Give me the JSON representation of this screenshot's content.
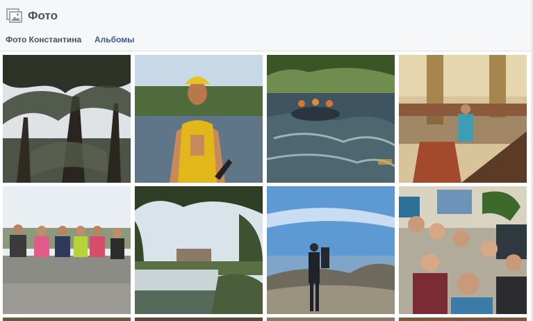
{
  "header": {
    "title": "Фото",
    "icon": "photos-icon"
  },
  "tabs": [
    {
      "label": "Фото Константина",
      "active": true
    },
    {
      "label": "Альбомы",
      "active": false
    }
  ],
  "colors": {
    "tab_link": "#365899",
    "header_bg": "#f6f7f9",
    "title": "#4b4f56"
  },
  "photos": [
    {
      "subject": "trees against the sky"
    },
    {
      "subject": "man in a yellow life vest and helmet by a river"
    },
    {
      "subject": "rafting on river rapids"
    },
    {
      "subject": "man on a grand staircase"
    },
    {
      "subject": "group of teenagers sitting on a wall"
    },
    {
      "subject": "waterfall with a castle in the distance"
    },
    {
      "subject": "hiker on a mountain top by the sea"
    },
    {
      "subject": "group selfie of students in a classroom",
      "watermark": ""
    }
  ]
}
